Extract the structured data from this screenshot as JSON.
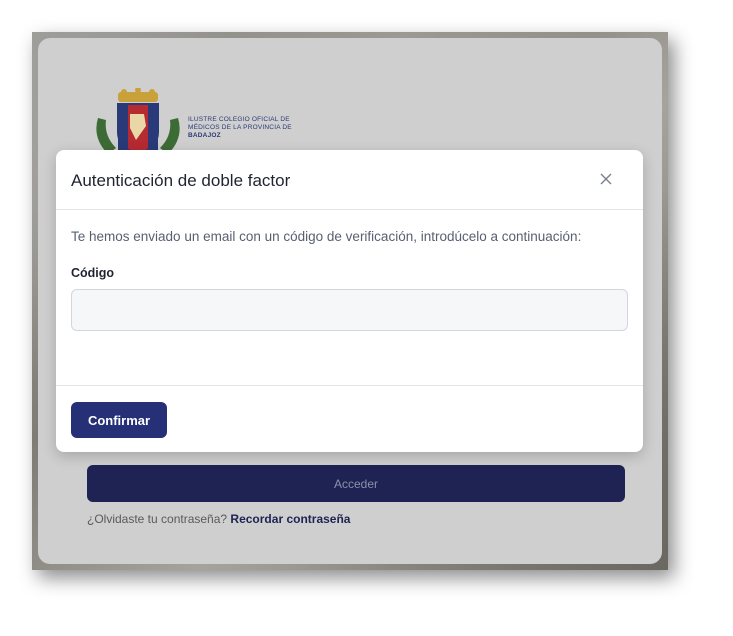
{
  "organization": {
    "name_line1": "ILUSTRE COLEGIO OFICIAL DE",
    "name_line2": "MÉDICOS DE LA PROVINCIA DE",
    "name_line3": "BADAJOZ"
  },
  "login": {
    "submit_label": "Acceder",
    "forgot_prompt": "¿Olvidaste tu contraseña?",
    "forgot_link": "Recordar contraseña"
  },
  "modal": {
    "title": "Autenticación de doble factor",
    "close_icon": "close-icon",
    "message": "Te hemos enviado un email con un código de verificación, introdúcelo a continuación:",
    "code_label": "Código",
    "code_value": "",
    "confirm_label": "Confirmar"
  },
  "colors": {
    "primary": "#253077",
    "login_button": "#1e2353",
    "overlay": "#cfcfcf"
  }
}
